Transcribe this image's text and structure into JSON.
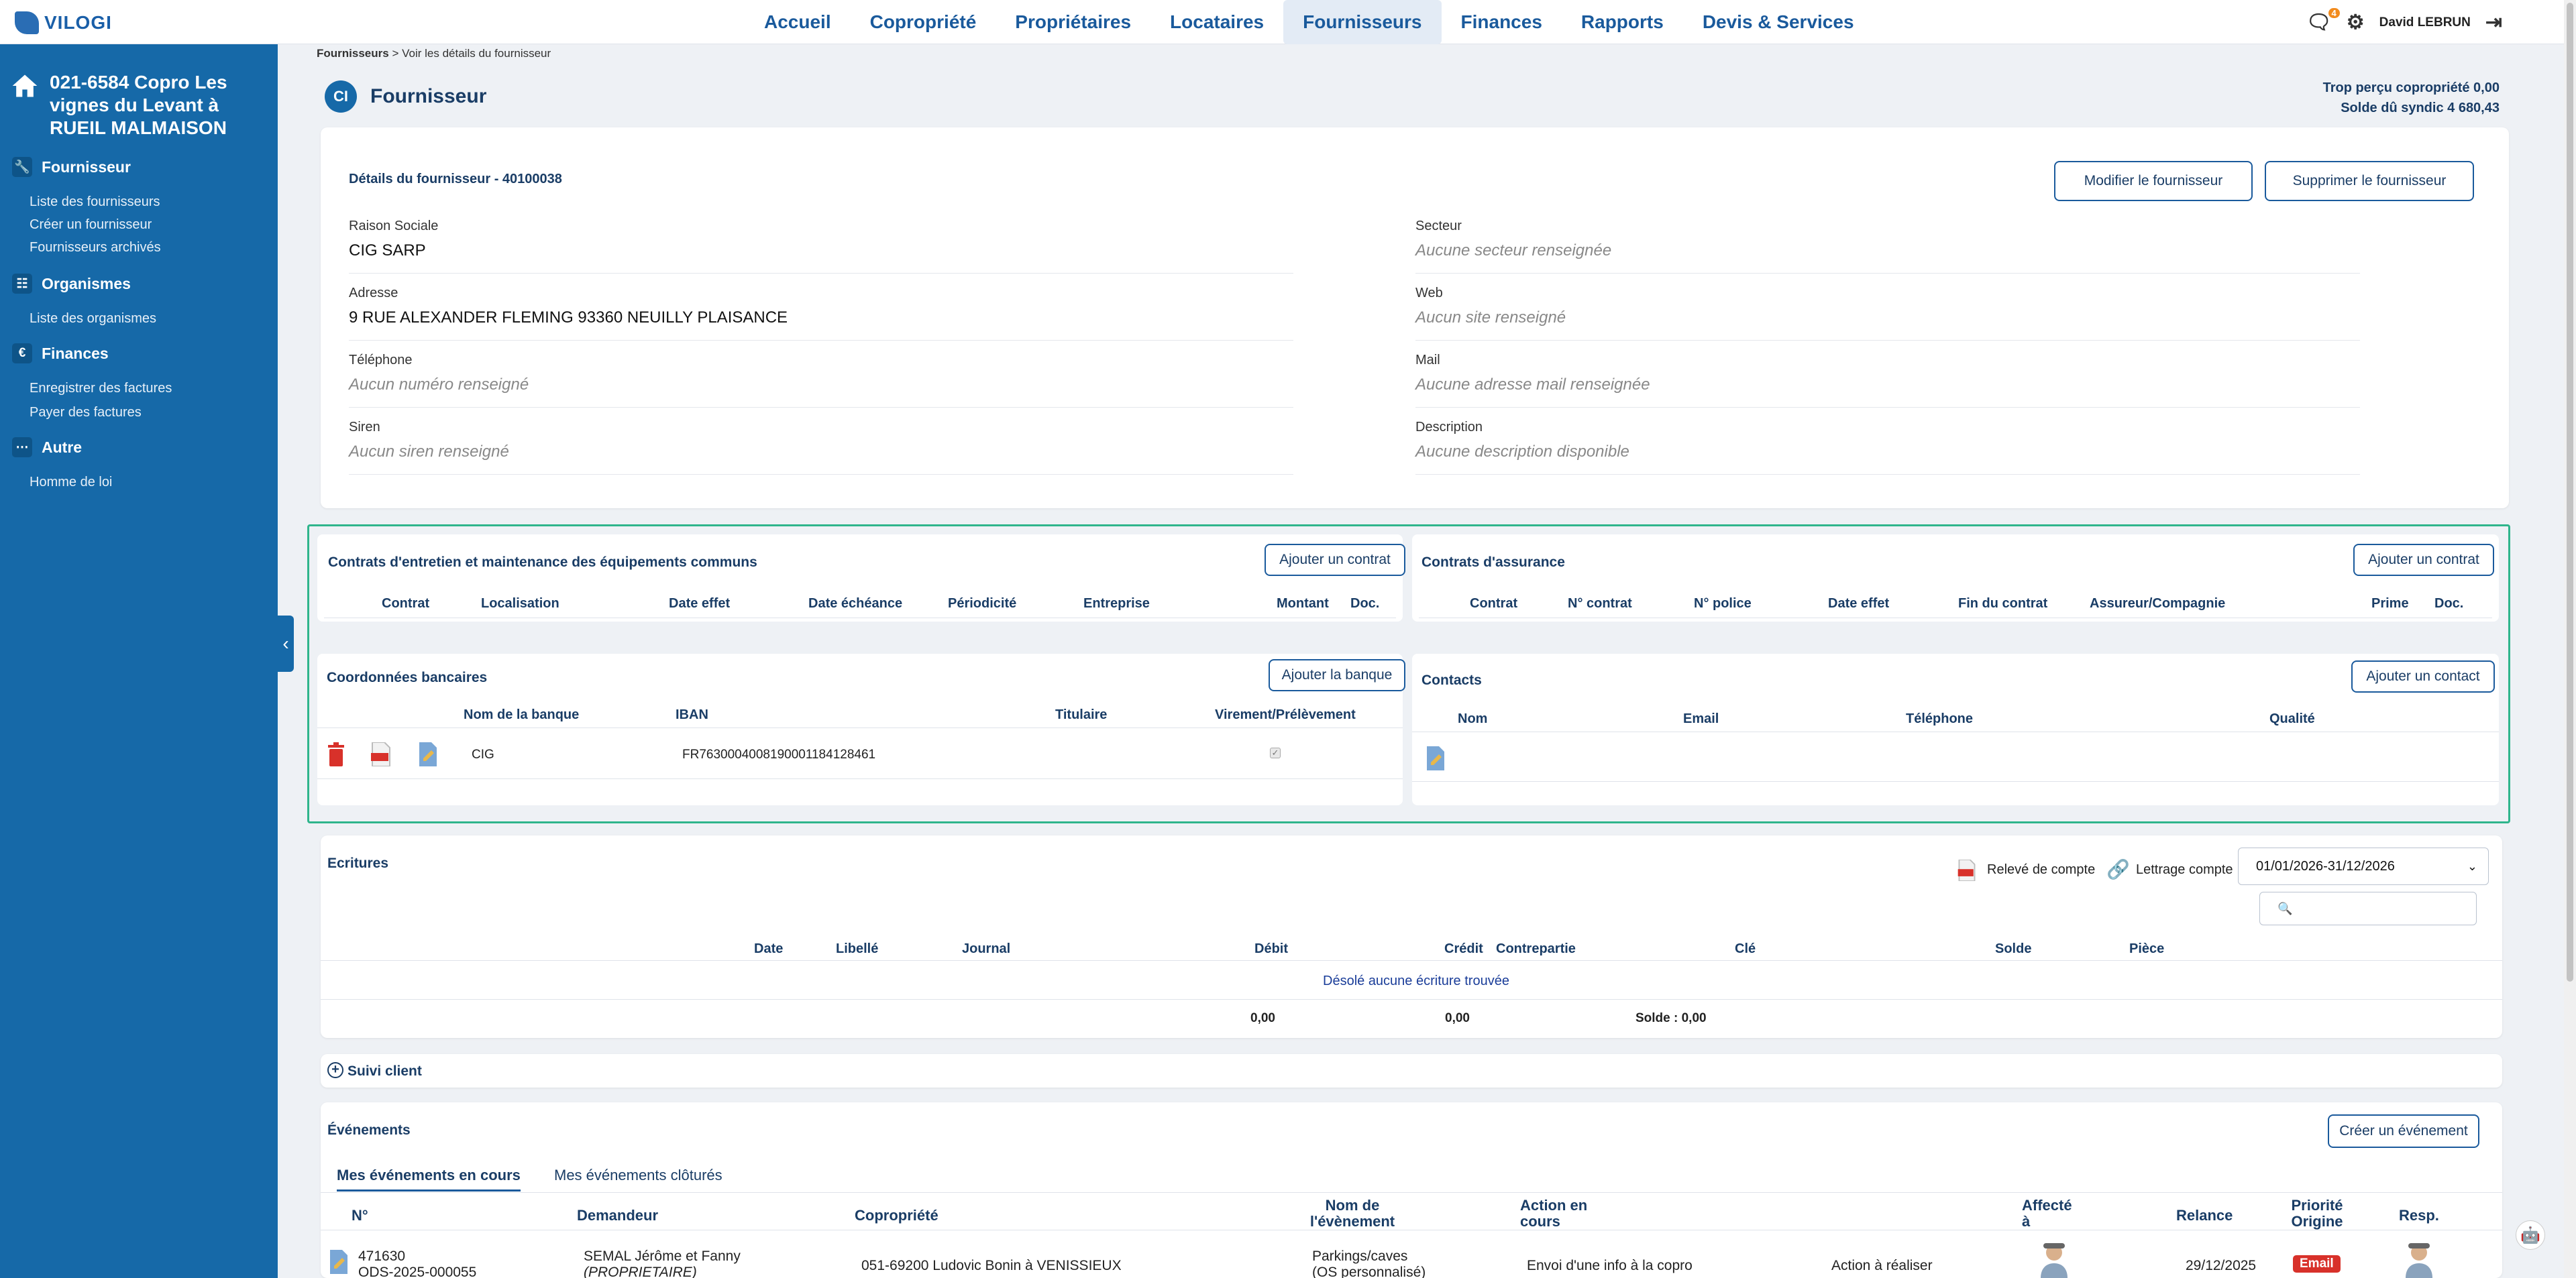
{
  "app": {
    "logo_text": "VILOGI",
    "user_name": "David LEBRUN",
    "notif_count": "4"
  },
  "nav": [
    "Accueil",
    "Copropriété",
    "Propriétaires",
    "Locataires",
    "Fournisseurs",
    "Finances",
    "Rapports",
    "Devis & Services"
  ],
  "sidebar": {
    "title": "021-6584 Copro Les vignes du Levant à RUEIL MALMAISON",
    "sections": [
      {
        "label": "Fournisseur",
        "icon": "wrench-icon",
        "links": [
          "Liste des fournisseurs",
          "Créer un fournisseur",
          "Fournisseurs archivés"
        ]
      },
      {
        "label": "Organismes",
        "icon": "org-chart-icon",
        "links": [
          "Liste des organismes"
        ]
      },
      {
        "label": "Finances",
        "icon": "euro-icon",
        "links": [
          "Enregistrer des factures",
          "Payer des factures"
        ]
      },
      {
        "label": "Autre",
        "icon": "more-icon",
        "links": [
          "Homme de loi"
        ]
      }
    ]
  },
  "breadcrumb": {
    "root": "Fournisseurs",
    "sep": ">",
    "current": "Voir les détails du fournisseur"
  },
  "page": {
    "badge": "CI",
    "title": "Fournisseur",
    "balance1": "Trop perçu copropriété 0,00",
    "balance2": "Solde dû syndic 4 680,43"
  },
  "supplier": {
    "heading": "Détails du fournisseur - 40100038",
    "edit_label": "Modifier le fournisseur",
    "delete_label": "Supprimer le fournisseur",
    "fields_left": [
      {
        "label": "Raison Sociale",
        "value": "CIG SARP",
        "empty": false
      },
      {
        "label": "Adresse",
        "value": "9 RUE ALEXANDER FLEMING 93360 NEUILLY PLAISANCE",
        "empty": false
      },
      {
        "label": "Téléphone",
        "value": "Aucun numéro renseigné",
        "empty": true
      },
      {
        "label": "Siren",
        "value": "Aucun siren renseigné",
        "empty": true
      }
    ],
    "fields_right": [
      {
        "label": "Secteur",
        "value": "Aucune secteur renseignée",
        "empty": true
      },
      {
        "label": "Web",
        "value": "Aucun site renseigné",
        "empty": true
      },
      {
        "label": "Mail",
        "value": "Aucune adresse mail renseignée",
        "empty": true
      },
      {
        "label": "Description",
        "value": "Aucune description disponible",
        "empty": true
      }
    ]
  },
  "contracts": {
    "title": "Contrats d'entretien et maintenance des équipements communs",
    "add_label": "Ajouter un contrat",
    "columns": [
      "Contrat",
      "Localisation",
      "Date effet",
      "Date échéance",
      "Périodicité",
      "Entreprise",
      "Montant",
      "Doc."
    ]
  },
  "insurance": {
    "title": "Contrats d'assurance",
    "add_label": "Ajouter un contrat",
    "columns": [
      "Contrat",
      "N° contrat",
      "N° police",
      "Date effet",
      "Fin du contrat",
      "Assureur/Compagnie",
      "Prime",
      "Doc."
    ]
  },
  "bank": {
    "title": "Coordonnées bancaires",
    "add_label": "Ajouter la banque",
    "columns": [
      "Nom de la banque",
      "IBAN",
      "Titulaire",
      "Virement/Prélèvement"
    ],
    "rows": [
      {
        "bank": "CIG",
        "iban": "FR7630004008190001184128461",
        "holder": ""
      }
    ]
  },
  "contacts": {
    "title": "Contacts",
    "add_label": "Ajouter un contact",
    "columns": [
      "Nom",
      "Email",
      "Téléphone",
      "Qualité"
    ]
  },
  "ecritures": {
    "title": "Ecritures",
    "releve_label": "Relevé de compte",
    "lettrage_label": "Lettrage compte",
    "period": "01/01/2026-31/12/2026",
    "search_placeholder": "",
    "columns": [
      "Date",
      "Libellé",
      "Journal",
      "Débit",
      "Crédit",
      "Contrepartie",
      "Clé",
      "Solde",
      "Pièce"
    ],
    "empty_msg": "Désolé aucune écriture trouvée",
    "total_debit": "0,00",
    "total_credit": "0,00",
    "total_solde": "Solde : 0,00"
  },
  "suivi": {
    "label": "Suivi client"
  },
  "events": {
    "title": "Événements",
    "create_label": "Créer un événement",
    "tabs": [
      "Mes événements en cours",
      "Mes événements clôturés"
    ],
    "columns": [
      "N°",
      "Demandeur",
      "Copropriété",
      "Nom de l'évènement",
      "Action en cours",
      "Affecté à",
      "Relance",
      "Priorité Origine",
      "Resp."
    ],
    "row": {
      "num1": "471630",
      "num2": "ODS-2025-000055",
      "req1": "SEMAL Jérôme et Fanny",
      "req2": "(PROPRIETAIRE)",
      "copro": "051-69200 Ludovic Bonin à VENISSIEUX",
      "name1": "Parkings/caves",
      "name2": "(OS personnalisé)",
      "action": "Envoi d'une info à la copro",
      "action2": "Action à réaliser",
      "relance": "29/12/2025",
      "origin": "Email"
    }
  }
}
